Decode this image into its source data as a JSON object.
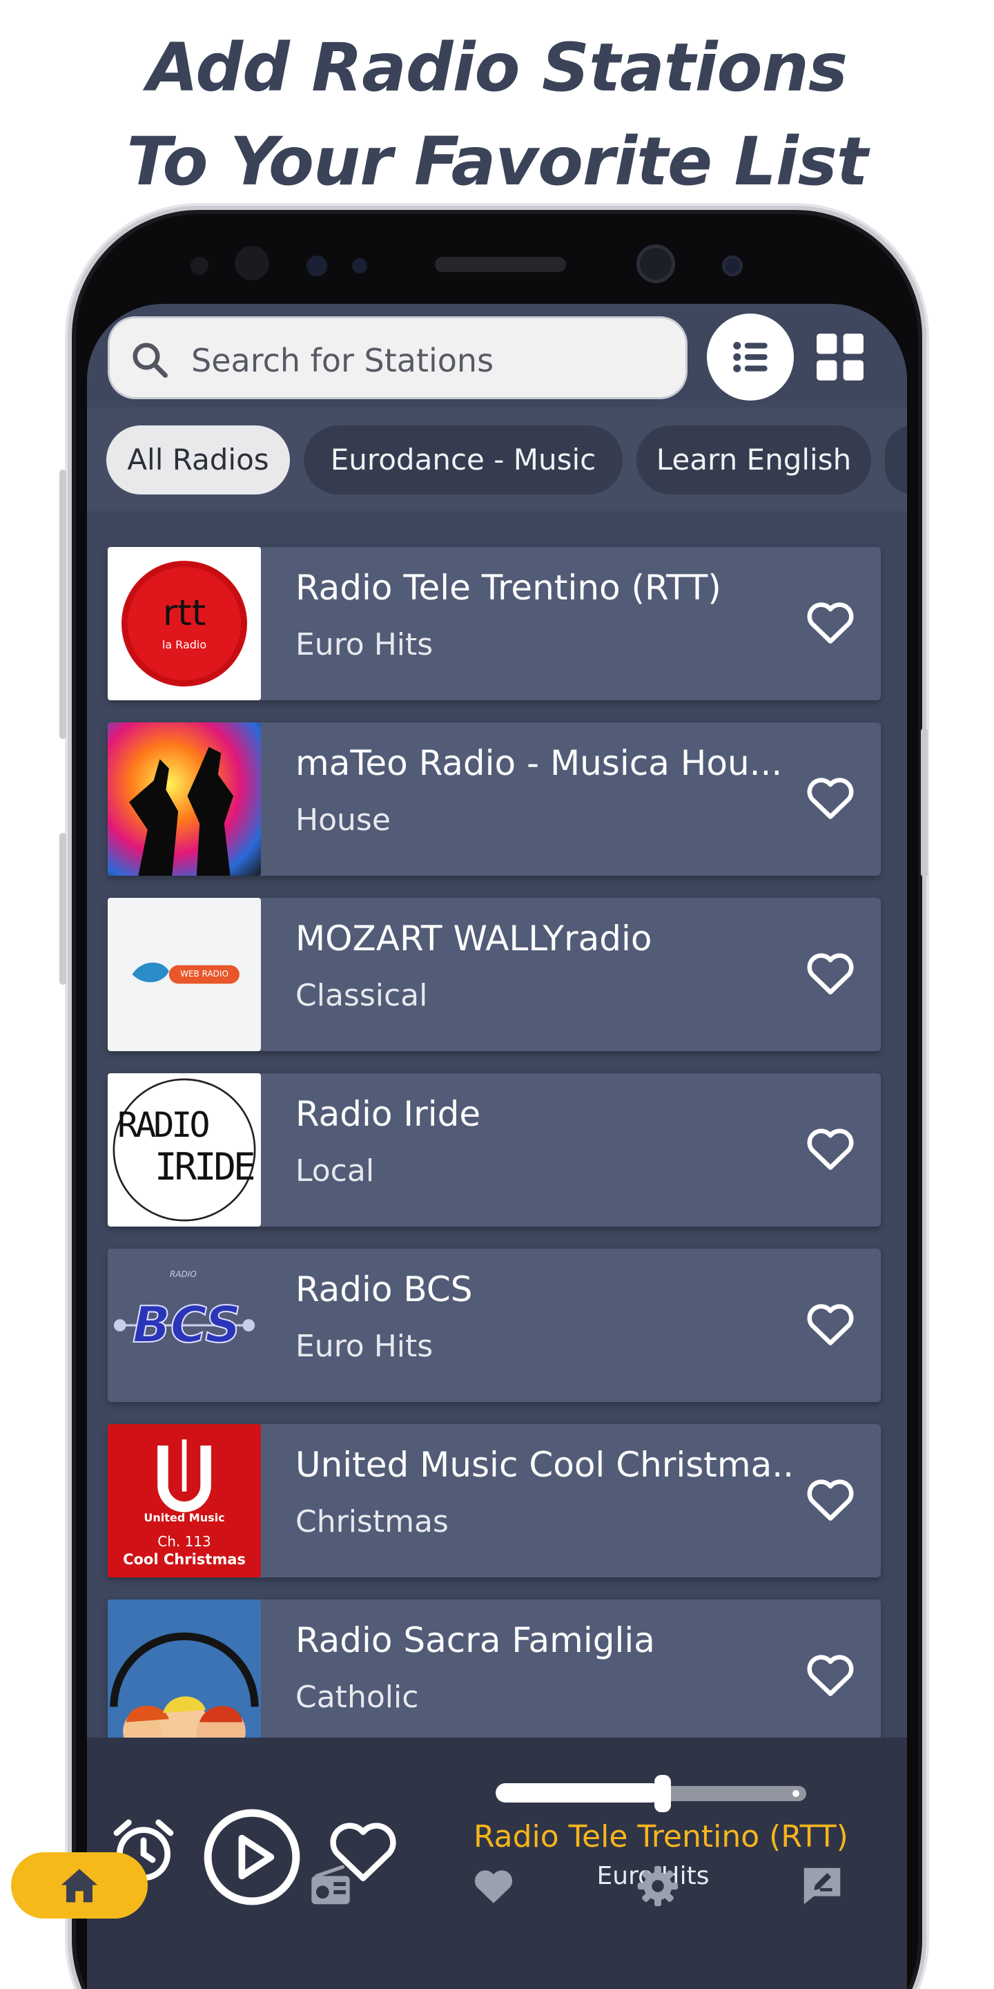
{
  "headline": {
    "line1": "Add Radio Stations",
    "line2": "To Your Favorite List"
  },
  "search": {
    "placeholder": "Search for Stations",
    "icon": "search-icon"
  },
  "view_toggle": {
    "list_icon": "list-view-icon",
    "grid_icon": "grid-view-icon",
    "active": "list"
  },
  "filters": [
    {
      "label": "All Radios",
      "active": true
    },
    {
      "label": "Eurodance - Music",
      "active": false
    },
    {
      "label": "Learn English",
      "active": false
    }
  ],
  "stations": [
    {
      "name": "Radio Tele Trentino (RTT)",
      "genre": "Euro Hits",
      "logo": "rtt-logo"
    },
    {
      "name": "maTeo Radio - Musica Hou...",
      "genre": "House",
      "logo": "dancers-image"
    },
    {
      "name": "MOZART WALLYradio",
      "genre": "Classical",
      "logo": "webradio-logo"
    },
    {
      "name": "Radio Iride",
      "genre": "Local",
      "logo": "radio-iride-logo"
    },
    {
      "name": "Radio BCS",
      "genre": "Euro Hits",
      "logo": "bcs-logo"
    },
    {
      "name": "United Music Cool Christma...",
      "genre": "Christmas",
      "logo": "united-music-logo"
    },
    {
      "name": "Radio Sacra Famiglia",
      "genre": "Catholic",
      "logo": "cartoon-logo"
    }
  ],
  "logo_text": {
    "rtt": "rtt",
    "rtt_sub": "la Radio",
    "web": "WEB RADIO",
    "iride_1": "RADIO",
    "iride_2": "IRIDE",
    "bcs_top": "RADIO",
    "bcs": "BCS",
    "um_1": "United Music",
    "um_2": "Ch. 113",
    "um_3": "Cool Christmas"
  },
  "player": {
    "title": "Radio Tele Trentino (RTT)",
    "subtitle": "Euro Hits",
    "volume_fraction": 0.55,
    "controls": [
      "alarm-icon",
      "play-icon",
      "heart-icon"
    ]
  },
  "nav": [
    "home-icon",
    "radio-icon",
    "favorites-icon",
    "settings-icon",
    "feedback-icon"
  ],
  "colors": {
    "accent": "#f6b91a",
    "now_playing": "#f7b51c",
    "card": "#525c77",
    "background": "#3e475e"
  }
}
